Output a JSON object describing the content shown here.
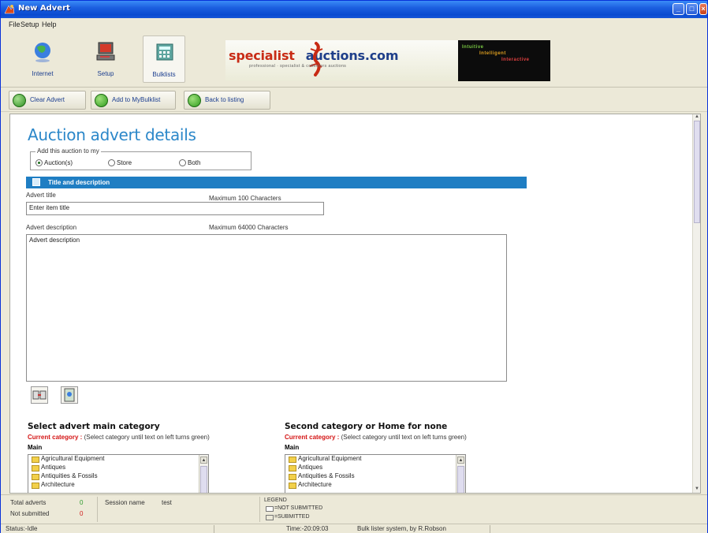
{
  "window": {
    "title": "New Advert"
  },
  "menu": {
    "items": [
      "File",
      "Setup",
      "Help"
    ]
  },
  "toolbar": {
    "buttons": [
      {
        "label": "Internet",
        "icon": "globe-icon"
      },
      {
        "label": "Setup",
        "icon": "computer-icon"
      },
      {
        "label": "Bulklists",
        "icon": "calculator-icon"
      }
    ]
  },
  "banner": {
    "logo_part1": "specialist",
    "logo_part2": "auctions.com",
    "tagline": "professional · specialist & collectors auctions",
    "tags": [
      "Intuitive",
      "Intelligent",
      "Interactive"
    ],
    "colors": {
      "red": "#c82b15",
      "blue": "#1f3f8a",
      "tag1": "#7ac943",
      "tag2": "#e0a020",
      "tag3": "#e04040"
    }
  },
  "actions": {
    "clear": "Clear Advert",
    "add": "Add to MyBulklist",
    "back": "Back to listing"
  },
  "form": {
    "page_title": "Auction advert details",
    "add_to": {
      "legend": "Add this auction to my",
      "options": [
        "Auction(s)",
        "Store",
        "Both"
      ],
      "selected": "Auction(s)"
    },
    "section_title": "Title and description",
    "advert_title_label": "Advert title",
    "advert_title_max": "Maximum 100 Characters",
    "advert_title_value": "Enter item title",
    "advert_desc_label": "Advert description",
    "advert_desc_max": "Maximum 64000 Characters",
    "advert_desc_value": "Advert description"
  },
  "categories": {
    "main_title": "Select advert main category",
    "second_title": "Second category or Home for none",
    "current_label": "Current category :",
    "current_hint": "(Select category until text on left turns green)",
    "main_label": "Main",
    "items": [
      "Agricultural Equipment",
      "Antiques",
      "Antiquities & Fossils",
      "Architecture"
    ]
  },
  "info": {
    "total_label": "Total adverts",
    "total_value": "0",
    "notsub_label": "Not submitted",
    "notsub_value": "0",
    "session_label": "Session name",
    "session_value": "test",
    "legend_title": "LEGEND",
    "legend_not": "=NOT SUBMITTED",
    "legend_sub": "=SUBMITTED",
    "colors": {
      "total": "#2e9c2e",
      "notsub": "#d01c1c"
    }
  },
  "status": {
    "status_text": "Status:-Idle",
    "time_text": "Time:-20:09:03",
    "credit": "Bulk lister system, by R.Robson"
  }
}
